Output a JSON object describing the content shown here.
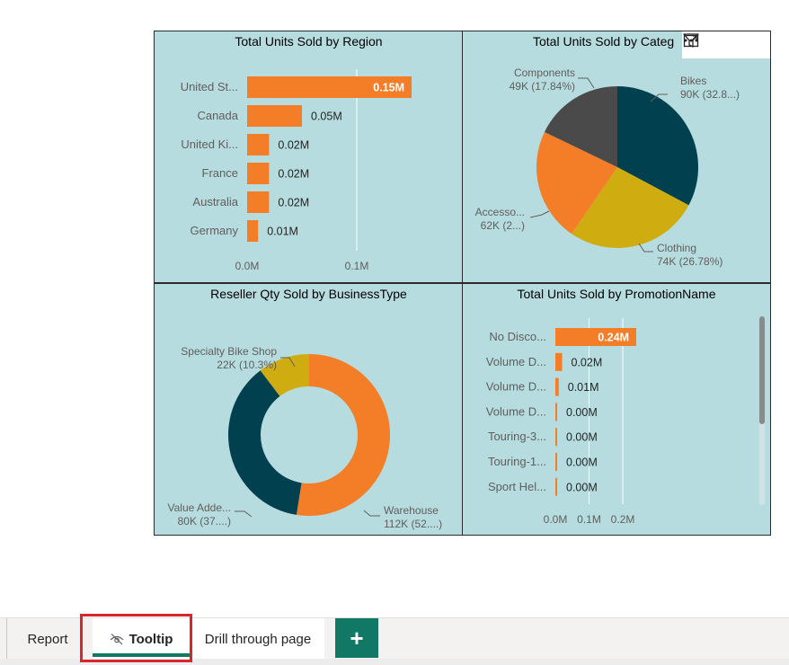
{
  "colors": {
    "orange": "#f47d28",
    "dark_teal": "#00404f",
    "gold": "#cfad10",
    "dark_gray": "#4a4a4a",
    "visual_bg": "#b6dcdf",
    "tab_accent": "#117865",
    "highlight": "#d9262c"
  },
  "header_icons": [
    "filter-icon",
    "focus-mode-icon",
    "more-options-icon"
  ],
  "chart_data": [
    {
      "type": "bar",
      "orientation": "horizontal",
      "title": "Total Units Sold by Region",
      "categories": [
        "United St...",
        "Canada",
        "United Ki...",
        "France",
        "Australia",
        "Germany"
      ],
      "values": [
        0.15,
        0.05,
        0.02,
        0.02,
        0.02,
        0.01
      ],
      "data_labels": [
        "0.15M",
        "0.05M",
        "0.02M",
        "0.02M",
        "0.02M",
        "0.01M"
      ],
      "x_ticks": [
        "0.0M",
        "0.1M"
      ],
      "xlim": [
        0,
        0.1
      ],
      "grid": true
    },
    {
      "type": "pie",
      "title": "Total Units Sold by Categ",
      "slices": [
        {
          "name": "Bikes",
          "label": "90K (32.8...)",
          "value": 32.8,
          "color": "#00404f"
        },
        {
          "name": "Clothing",
          "label": "74K (26.78%)",
          "value": 26.78,
          "color": "#cfad10"
        },
        {
          "name": "Accesso...",
          "label": "62K (2...)",
          "value": 22.58,
          "color": "#f47d28"
        },
        {
          "name": "Components",
          "label": "49K (17.84%)",
          "value": 17.84,
          "color": "#4a4a4a"
        }
      ]
    },
    {
      "type": "donut",
      "title": "Reseller Qty Sold by BusinessType",
      "slices": [
        {
          "name": "Warehouse",
          "label": "112K (52....)",
          "value": 52.5,
          "color": "#f47d28"
        },
        {
          "name": "Value Adde...",
          "label": "80K (37....)",
          "value": 37.2,
          "color": "#00404f"
        },
        {
          "name": "Specialty Bike Shop",
          "label": "22K (10.3%)",
          "value": 10.3,
          "color": "#cfad10"
        }
      ]
    },
    {
      "type": "bar",
      "orientation": "horizontal",
      "title": "Total Units Sold by PromotionName",
      "categories": [
        "No Disco...",
        "Volume D...",
        "Volume D...",
        "Volume D...",
        "Touring-3...",
        "Touring-1...",
        "Sport Hel..."
      ],
      "values": [
        0.24,
        0.02,
        0.01,
        0.003,
        0.002,
        0.002,
        0.002
      ],
      "data_labels": [
        "0.24M",
        "0.02M",
        "0.01M",
        "0.00M",
        "0.00M",
        "0.00M",
        "0.00M"
      ],
      "x_ticks": [
        "0.0M",
        "0.1M",
        "0.2M"
      ],
      "xlim": [
        0,
        0.2
      ],
      "grid": true
    }
  ],
  "tabs": {
    "report": "Report",
    "tooltip": "Tooltip",
    "drill": "Drill through page",
    "add": "+"
  }
}
